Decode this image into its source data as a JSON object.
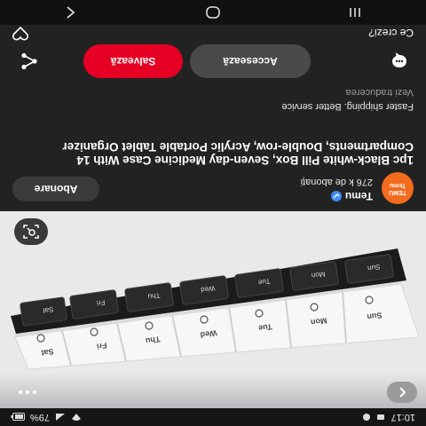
{
  "status_bar": {
    "time": "10:17",
    "battery": "79%",
    "signal_icon": "signal-icon",
    "wifi_icon": "wifi-icon"
  },
  "hero": {
    "alt": "Pill box image",
    "day_labels_top": [
      "Sun",
      "Mon",
      "Tue",
      "Wed",
      "Thu",
      "Fri",
      "Sat"
    ]
  },
  "seller": {
    "logo_text_1": "TEMU",
    "logo_text_2": "Temu",
    "name": "Temu",
    "followers": "276 k de abonați",
    "follow_label": "Abonare"
  },
  "product": {
    "title": "1pc Black-white Pill Box, Seven-day Medicine Case With 14 Compartments, Double-row, Acrylic Portable Tablet Organizer",
    "subtitle": "Faster shipping. Better service",
    "translate_link": "Vezi traducerea"
  },
  "actions": {
    "visit_label": "Accesează",
    "save_label": "Salvează"
  },
  "footer": {
    "question": "Ce crezi?"
  },
  "colors": {
    "save": "#e60023",
    "temu_orange": "#f36b1c"
  }
}
